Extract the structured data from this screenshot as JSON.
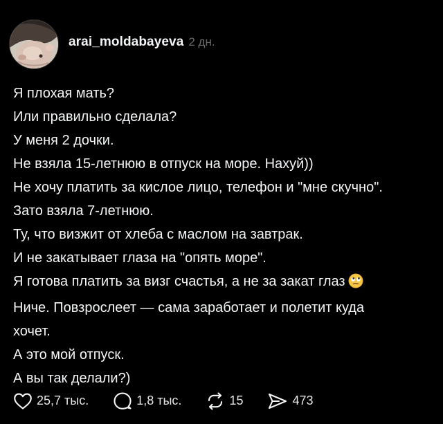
{
  "author": {
    "username": "arai_moldabayeva",
    "time": "2 дн."
  },
  "post_lines": [
    "Я плохая мать?",
    "Или правильно сделала?",
    "У меня 2 дочки.",
    "Не взяла 15-летнюю в отпуск на море. Нахуй))",
    "Не хочу платить за кислое лицо, телефон и \"мне скучно\".",
    "Зато взяла 7-летнюю.",
    "Ту, что визжит от хлеба с маслом на завтрак.",
    "И не закатывает глаза на \"опять море\".",
    "Я готова платить за визг счастья, а не за закат глаз",
    "Ниче. Повзрослеет — сама заработает и полетит куда",
    "хочет.",
    "А это мой отпуск.",
    "А вы так делали?)"
  ],
  "emoji": "face-with-rolling-eyes",
  "actions": {
    "likes": "25,7 тыс.",
    "comments": "1,8 тыс.",
    "reposts": "15",
    "shares": "473"
  },
  "colors": {
    "background": "#000000",
    "text": "#f3f5f7",
    "muted": "#6b6b6b"
  }
}
